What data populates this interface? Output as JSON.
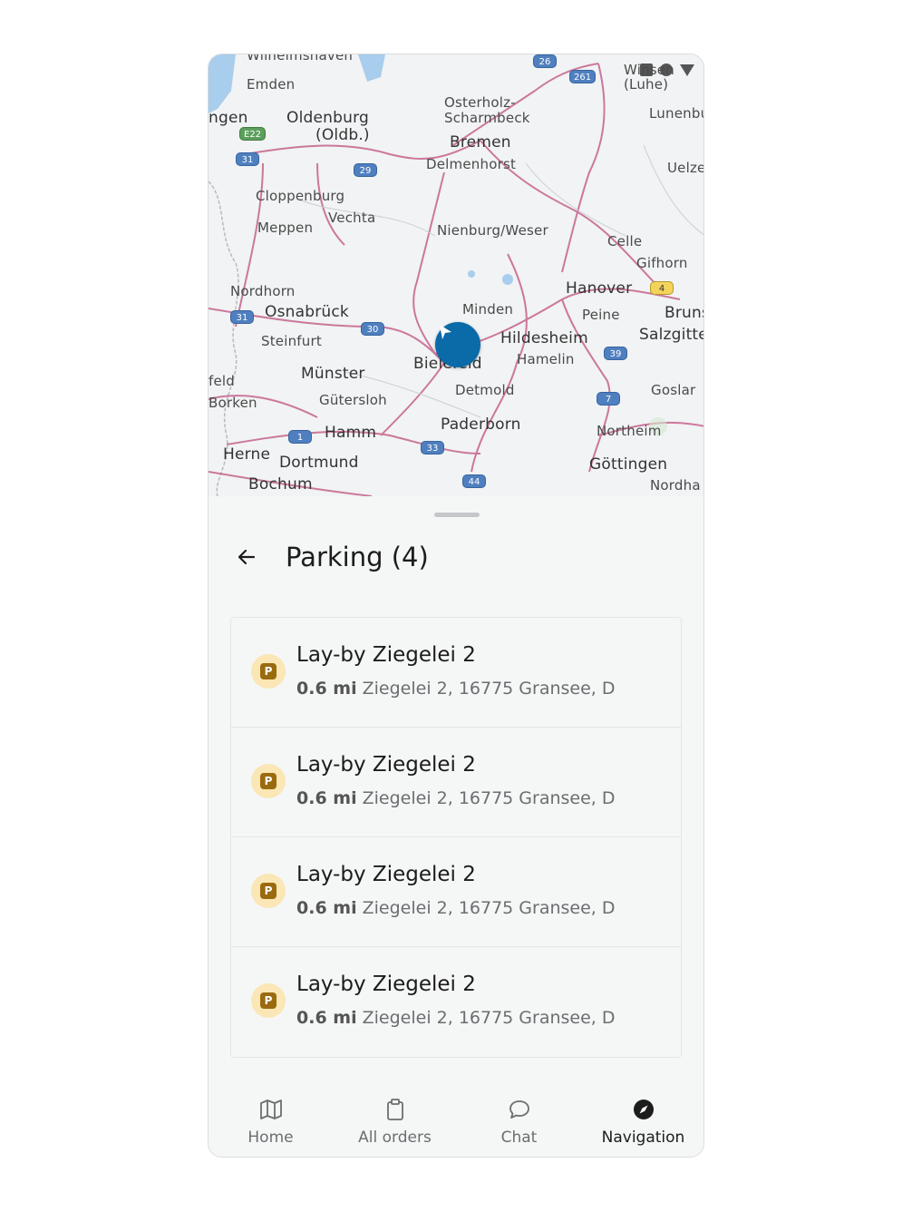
{
  "map": {
    "labels": {
      "wilhelmshaven": "Wilhelmshaven",
      "emden": "Emden",
      "ngen": "ngen",
      "oldenburg": "Oldenburg",
      "oldb": "(Oldb.)",
      "osterholz": "Osterholz-",
      "scharmbeck": "Scharmbeck",
      "bremen": "Bremen",
      "delmenhorst": "Delmenhorst",
      "cloppenburg": "Cloppenburg",
      "vechta": "Vechta",
      "meppen": "Meppen",
      "nienburg": "Nienburg/Weser",
      "celle": "Celle",
      "gifhorn": "Gifhorn",
      "nordhorn": "Nordhorn",
      "osnabrueck": "Osnabrück",
      "minden": "Minden",
      "hanover": "Hanover",
      "peine": "Peine",
      "bruns": "Bruns",
      "steinfurt": "Steinfurt",
      "hildesheim": "Hildesheim",
      "salzgitte": "Salzgitte",
      "bielefeld": "Bielefeld",
      "hamelin": "Hamelin",
      "feld": "feld",
      "muenster": "Münster",
      "detmold": "Detmold",
      "goslar": "Goslar",
      "borken": "Borken",
      "guetersloh": "Gütersloh",
      "paderborn": "Paderborn",
      "northeim": "Northeim",
      "hamm": "Hamm",
      "herne": "Herne",
      "dortmund": "Dortmund",
      "goettingen": "Göttingen",
      "bochum": "Bochum",
      "nordha": "Nordha",
      "luhe": "(Luhe)",
      "winsen": "Winsen",
      "lunenbu": "Lunenbu",
      "uelze": "Uelze"
    },
    "shields": [
      "26",
      "261",
      "E22",
      "31",
      "29",
      "31",
      "30",
      "39",
      "4",
      "7",
      "1",
      "33",
      "44"
    ]
  },
  "sheet": {
    "title": "Parking (4)",
    "items": [
      {
        "badge": "P",
        "title": "Lay-by Ziegelei 2",
        "distance": "0.6 mi",
        "address": "Ziegelei 2, 16775 Gransee, D"
      },
      {
        "badge": "P",
        "title": "Lay-by Ziegelei 2",
        "distance": "0.6 mi",
        "address": "Ziegelei 2, 16775 Gransee, D"
      },
      {
        "badge": "P",
        "title": "Lay-by Ziegelei 2",
        "distance": "0.6 mi",
        "address": "Ziegelei 2, 16775 Gransee, D"
      },
      {
        "badge": "P",
        "title": "Lay-by Ziegelei 2",
        "distance": "0.6 mi",
        "address": "Ziegelei 2, 16775 Gransee, D"
      }
    ]
  },
  "nav": {
    "items": [
      {
        "label": "Home",
        "icon": "map-icon"
      },
      {
        "label": "All orders",
        "icon": "clipboard-icon"
      },
      {
        "label": "Chat",
        "icon": "chat-bubble-icon"
      },
      {
        "label": "Navigation",
        "icon": "compass-icon"
      }
    ]
  },
  "colors": {
    "accent": "#0b6aa8",
    "parking_badge_bg": "#fbe6b5",
    "parking_badge_fg": "#9a6a0f"
  }
}
